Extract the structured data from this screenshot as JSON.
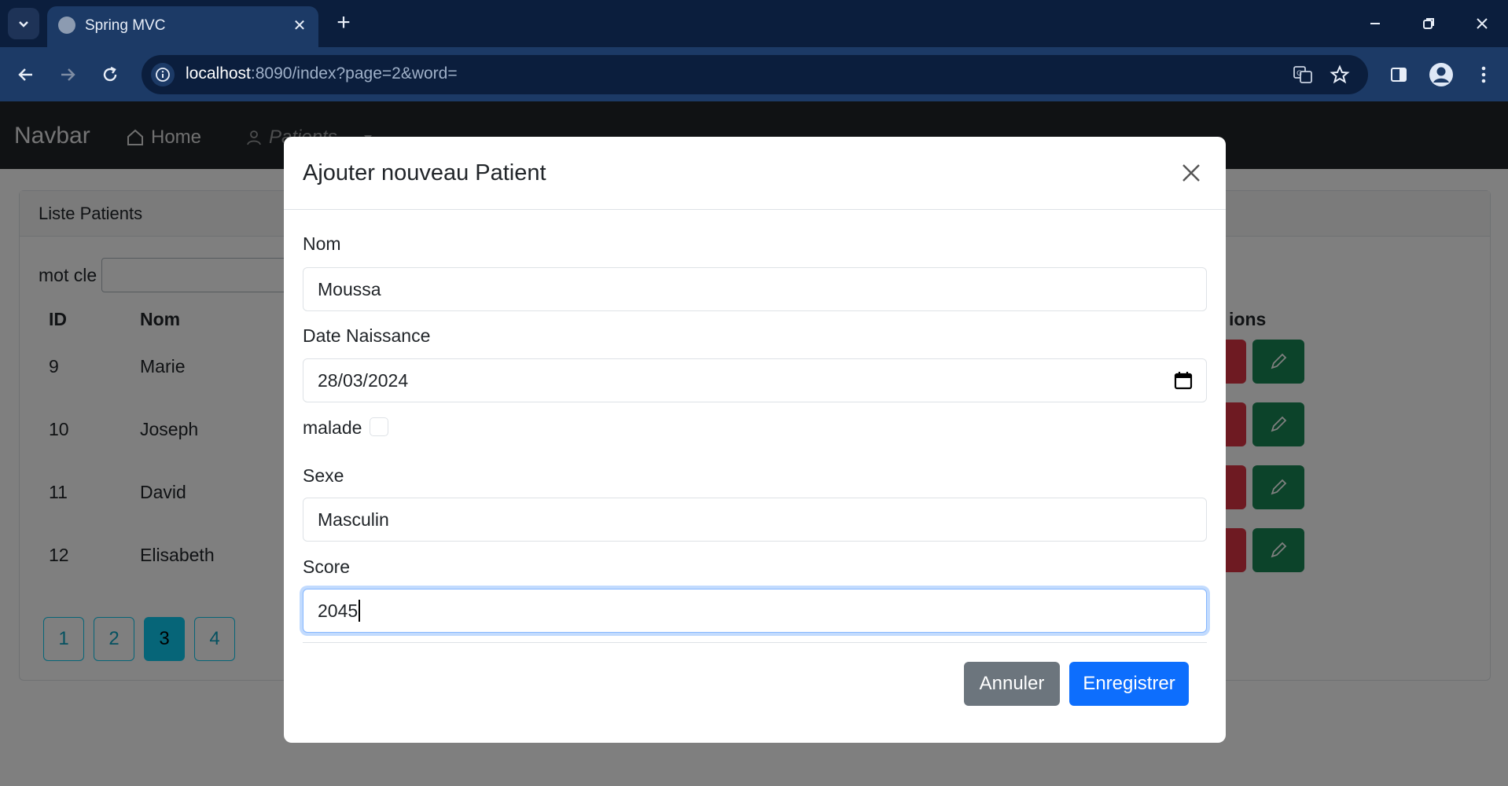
{
  "browser": {
    "tab_title": "Spring MVC",
    "url_host": "localhost",
    "url_rest": ":8090/index?page=2&word="
  },
  "navbar": {
    "brand": "Navbar",
    "home": "Home",
    "patients": "Patients"
  },
  "card": {
    "header": "Liste Patients",
    "search_label": "mot cle",
    "columns": [
      "ID",
      "Nom",
      "ions"
    ],
    "rows": [
      {
        "id": "9",
        "nom": "Marie"
      },
      {
        "id": "10",
        "nom": "Joseph"
      },
      {
        "id": "11",
        "nom": "David"
      },
      {
        "id": "12",
        "nom": "Elisabeth"
      }
    ],
    "pages": [
      "1",
      "2",
      "3",
      "4"
    ],
    "active_page": "3"
  },
  "modal": {
    "title": "Ajouter nouveau Patient",
    "nom_label": "Nom",
    "nom_value": "Moussa",
    "date_label": "Date Naissance",
    "date_value": "28/03/2024",
    "malade_label": "malade",
    "malade_checked": false,
    "sexe_label": "Sexe",
    "sexe_value": "Masculin",
    "score_label": "Score",
    "score_value": "2045",
    "cancel_label": "Annuler",
    "save_label": "Enregistrer"
  },
  "colors": {
    "primary": "#0d6efd",
    "secondary": "#6c757d",
    "danger": "#dc3545",
    "success": "#198754",
    "info": "#0dcaf0",
    "navbar_bg": "#212529"
  }
}
